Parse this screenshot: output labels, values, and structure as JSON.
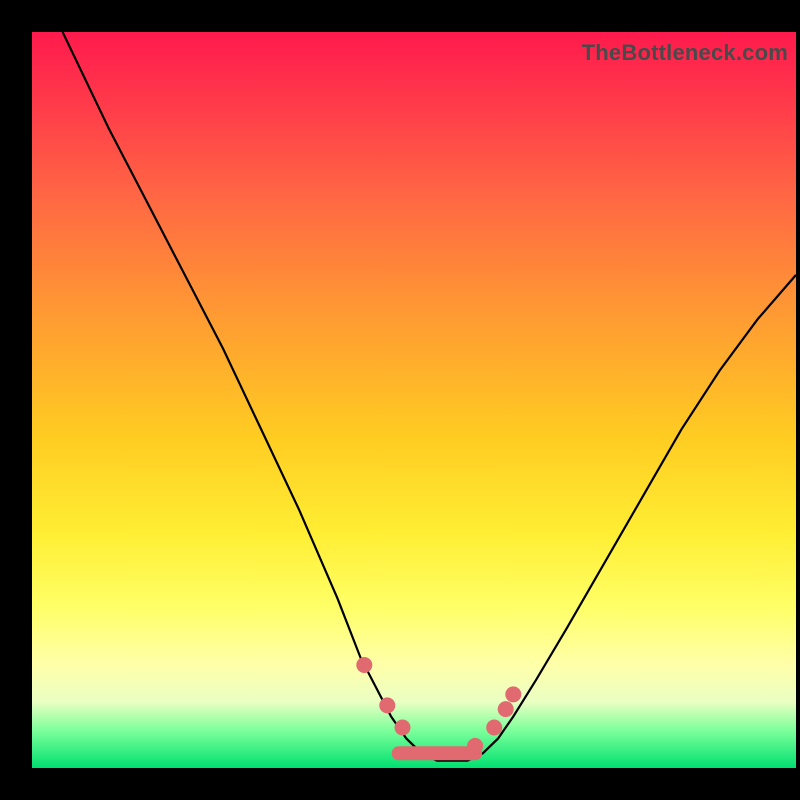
{
  "watermark": "TheBottleneck.com",
  "colors": {
    "background": "#000000",
    "marker": "#e06a6f",
    "curve": "#000000",
    "gradient_top": "#ff1a4d",
    "gradient_bottom": "#00e070"
  },
  "chart_data": {
    "type": "line",
    "title": "",
    "xlabel": "",
    "ylabel": "",
    "xlim": [
      0,
      100
    ],
    "ylim": [
      0,
      100
    ],
    "x": [
      4,
      10,
      15,
      20,
      25,
      30,
      35,
      40,
      43,
      45,
      47,
      49,
      51,
      53,
      55,
      57,
      59,
      61,
      63,
      66,
      70,
      75,
      80,
      85,
      90,
      95,
      100
    ],
    "y": [
      100,
      87,
      77,
      67,
      57,
      46,
      35,
      23,
      15,
      11,
      7,
      4,
      2,
      1,
      1,
      1,
      2,
      4,
      7,
      12,
      19,
      28,
      37,
      46,
      54,
      61,
      67
    ],
    "markers": {
      "x": [
        43.5,
        46.5,
        48.5,
        58.0,
        60.5,
        62.0,
        63.0
      ],
      "y": [
        14,
        8.5,
        5.5,
        3.0,
        5.5,
        8.0,
        10.0
      ]
    },
    "valley_band": {
      "x_start": 48,
      "x_end": 58,
      "y": 2
    }
  }
}
